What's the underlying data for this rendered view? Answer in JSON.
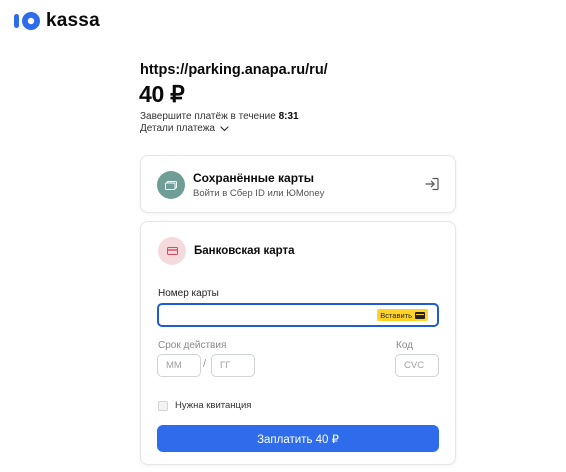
{
  "logo": {
    "text": "kassa",
    "icon": "yoomoney-logo-icon",
    "brand_color": "#2f6cec"
  },
  "payment": {
    "merchant_url": "https://parking.anapa.ru/ru/",
    "amount": "40 ₽",
    "timer_prefix": "Завершите платёж в течение",
    "timer_value": "8:31",
    "details_label": "Детали платежа"
  },
  "saved_cards": {
    "title": "Сохранённые карты",
    "subtitle": "Войти в Сбер ID или ЮMoney",
    "icon": "card-icon",
    "action_icon": "login-icon"
  },
  "bank_card": {
    "title": "Банковская карта",
    "icon": "bank-card-icon",
    "card_number_label": "Номер карты",
    "card_number_value": "",
    "paste_label": "Вставить",
    "expiry_label": "Срок действия",
    "month_placeholder": "ММ",
    "year_placeholder": "ГГ",
    "separator": "/",
    "cvc_label": "Код",
    "cvc_placeholder": "CVC",
    "receipt_label": "Нужна квитанция",
    "receipt_checked": false,
    "pay_button": "Заплатить 40 ₽"
  }
}
